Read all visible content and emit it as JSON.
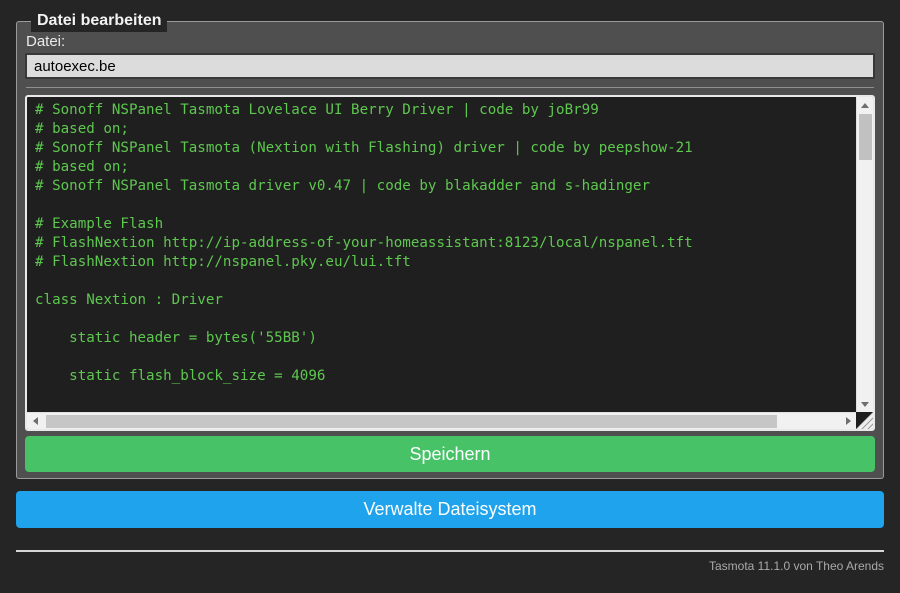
{
  "editor": {
    "legend": "Datei bearbeiten",
    "file_label": "Datei:",
    "file_value": "autoexec.be",
    "code_lines": [
      "# Sonoff NSPanel Tasmota Lovelace UI Berry Driver | code by joBr99",
      "# based on;",
      "# Sonoff NSPanel Tasmota (Nextion with Flashing) driver | code by peepshow-21",
      "# based on;",
      "# Sonoff NSPanel Tasmota driver v0.47 | code by blakadder and s-hadinger",
      "",
      "# Example Flash",
      "# FlashNextion http://ip-address-of-your-homeassistant:8123/local/nspanel.tft",
      "# FlashNextion http://nspanel.pky.eu/lui.tft",
      "",
      "class Nextion : Driver",
      "",
      "    static header = bytes('55BB')",
      "",
      "    static flash_block_size = 4096"
    ],
    "save_button_label": "Speichern"
  },
  "manage_button_label": "Verwalte Dateisystem",
  "footer": {
    "version_text": "Tasmota 11.1.0 von Theo Arends"
  },
  "colors": {
    "page_background": "#252525",
    "form_background": "#4f4f4f",
    "console_background": "#1f1f1f",
    "console_text": "#5ec74f",
    "input_background": "#dcdcdc",
    "save_button": "#47c266",
    "manage_button": "#1fa3ec",
    "button_text": "#fcffff",
    "footer_text": "#aaaaaa"
  }
}
